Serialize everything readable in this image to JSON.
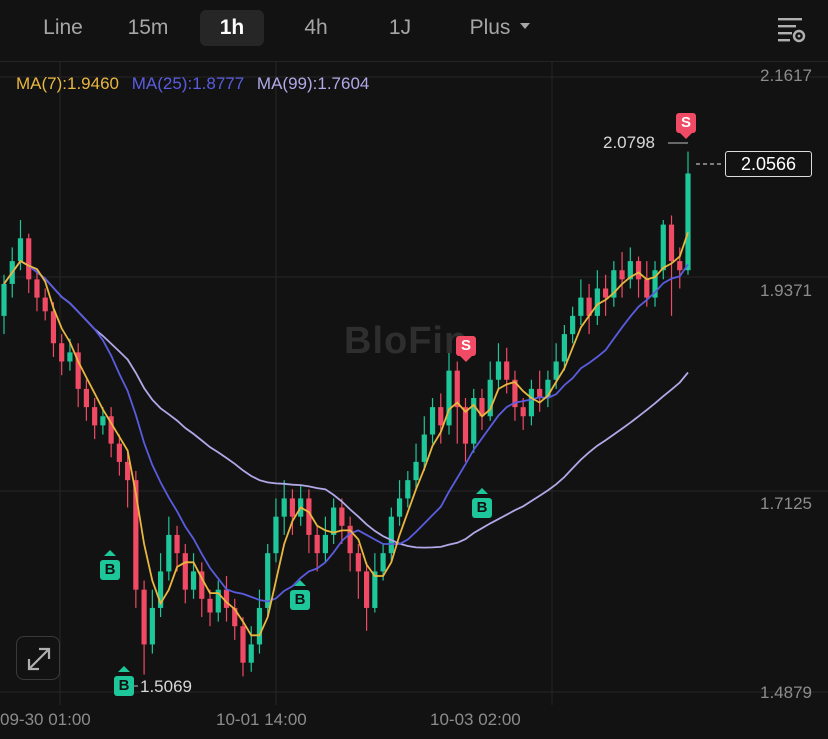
{
  "timeframes": [
    {
      "label": "Line",
      "active": false
    },
    {
      "label": "15m",
      "active": false
    },
    {
      "label": "1h",
      "active": true
    },
    {
      "label": "4h",
      "active": false
    },
    {
      "label": "1J",
      "active": false
    },
    {
      "label": "Plus",
      "active": false
    }
  ],
  "icons": {
    "settings": "chart-settings-icon",
    "expand": "expand-icon",
    "more": "caret-down-icon"
  },
  "ma_legend": [
    {
      "label": "MA(7):1.9460",
      "color": "#e9b73f"
    },
    {
      "label": "MA(25):1.8777",
      "color": "#5a5ce0"
    },
    {
      "label": "MA(99):1.7604",
      "color": "#b1a8e8"
    }
  ],
  "price_axis": {
    "ticks": [
      "2.1617",
      "1.9371",
      "1.7125",
      "1.4879"
    ]
  },
  "time_axis": {
    "ticks": [
      "09-30 01:00",
      "10-01 14:00",
      "10-03 02:00"
    ]
  },
  "last_price": "2.0566",
  "high_label": "2.0798",
  "low_label": "1.5069",
  "watermark": "BloFin",
  "markers": [
    {
      "type": "buy",
      "text": "B"
    },
    {
      "type": "buy",
      "text": "B"
    },
    {
      "type": "buy",
      "text": "B"
    },
    {
      "type": "buy",
      "text": "B"
    },
    {
      "type": "sell",
      "text": "S"
    },
    {
      "type": "sell",
      "text": "S"
    }
  ],
  "colors": {
    "up": "#1ec79a",
    "down": "#f04a64",
    "ma7": "#e9b73f",
    "ma25": "#5a5ce0",
    "ma99": "#b1a8e8",
    "grid": "#262626"
  },
  "chart_data": {
    "type": "candlestick",
    "ylim": [
      1.4879,
      2.1617
    ],
    "grid": true,
    "candles": [
      [
        1.9,
        1.935,
        1.88,
        1.945
      ],
      [
        1.935,
        1.96,
        1.92,
        1.975
      ],
      [
        1.96,
        1.985,
        1.95,
        2.005
      ],
      [
        1.985,
        1.94,
        1.925,
        1.99
      ],
      [
        1.94,
        1.92,
        1.905,
        1.95
      ],
      [
        1.92,
        1.905,
        1.895,
        1.93
      ],
      [
        1.905,
        1.87,
        1.855,
        1.915
      ],
      [
        1.87,
        1.85,
        1.835,
        1.88
      ],
      [
        1.85,
        1.86,
        1.84,
        1.875
      ],
      [
        1.86,
        1.82,
        1.8,
        1.87
      ],
      [
        1.82,
        1.8,
        1.785,
        1.83
      ],
      [
        1.8,
        1.78,
        1.765,
        1.81
      ],
      [
        1.78,
        1.79,
        1.77,
        1.8
      ],
      [
        1.79,
        1.76,
        1.745,
        1.8
      ],
      [
        1.76,
        1.74,
        1.725,
        1.77
      ],
      [
        1.74,
        1.72,
        1.69,
        1.75
      ],
      [
        1.72,
        1.6,
        1.58,
        1.73
      ],
      [
        1.6,
        1.54,
        1.507,
        1.61
      ],
      [
        1.54,
        1.58,
        1.53,
        1.6
      ],
      [
        1.58,
        1.62,
        1.57,
        1.64
      ],
      [
        1.62,
        1.66,
        1.61,
        1.68
      ],
      [
        1.66,
        1.64,
        1.62,
        1.67
      ],
      [
        1.64,
        1.6,
        1.585,
        1.65
      ],
      [
        1.6,
        1.62,
        1.59,
        1.64
      ],
      [
        1.62,
        1.59,
        1.57,
        1.63
      ],
      [
        1.59,
        1.575,
        1.56,
        1.6
      ],
      [
        1.575,
        1.6,
        1.565,
        1.61
      ],
      [
        1.6,
        1.58,
        1.565,
        1.615
      ],
      [
        1.58,
        1.56,
        1.545,
        1.59
      ],
      [
        1.56,
        1.52,
        1.505,
        1.57
      ],
      [
        1.52,
        1.54,
        1.51,
        1.56
      ],
      [
        1.54,
        1.58,
        1.53,
        1.6
      ],
      [
        1.58,
        1.64,
        1.57,
        1.65
      ],
      [
        1.64,
        1.68,
        1.63,
        1.7
      ],
      [
        1.68,
        1.7,
        1.66,
        1.72
      ],
      [
        1.7,
        1.68,
        1.66,
        1.71
      ],
      [
        1.68,
        1.7,
        1.67,
        1.715
      ],
      [
        1.7,
        1.66,
        1.64,
        1.71
      ],
      [
        1.66,
        1.64,
        1.62,
        1.67
      ],
      [
        1.64,
        1.66,
        1.63,
        1.68
      ],
      [
        1.66,
        1.69,
        1.65,
        1.7
      ],
      [
        1.69,
        1.67,
        1.65,
        1.7
      ],
      [
        1.67,
        1.64,
        1.62,
        1.68
      ],
      [
        1.64,
        1.62,
        1.59,
        1.65
      ],
      [
        1.62,
        1.58,
        1.555,
        1.63
      ],
      [
        1.58,
        1.62,
        1.575,
        1.64
      ],
      [
        1.62,
        1.64,
        1.61,
        1.65
      ],
      [
        1.64,
        1.68,
        1.63,
        1.69
      ],
      [
        1.68,
        1.7,
        1.67,
        1.72
      ],
      [
        1.7,
        1.72,
        1.69,
        1.73
      ],
      [
        1.72,
        1.74,
        1.71,
        1.76
      ],
      [
        1.74,
        1.77,
        1.73,
        1.79
      ],
      [
        1.77,
        1.8,
        1.76,
        1.81
      ],
      [
        1.8,
        1.78,
        1.76,
        1.815
      ],
      [
        1.78,
        1.84,
        1.77,
        1.88
      ],
      [
        1.84,
        1.8,
        1.76,
        1.85
      ],
      [
        1.8,
        1.76,
        1.74,
        1.81
      ],
      [
        1.76,
        1.81,
        1.75,
        1.82
      ],
      [
        1.81,
        1.79,
        1.775,
        1.82
      ],
      [
        1.79,
        1.83,
        1.785,
        1.85
      ],
      [
        1.83,
        1.85,
        1.82,
        1.87
      ],
      [
        1.85,
        1.83,
        1.815,
        1.865
      ],
      [
        1.83,
        1.8,
        1.785,
        1.84
      ],
      [
        1.8,
        1.79,
        1.775,
        1.81
      ],
      [
        1.79,
        1.82,
        1.78,
        1.83
      ],
      [
        1.82,
        1.81,
        1.795,
        1.84
      ],
      [
        1.81,
        1.83,
        1.8,
        1.84
      ],
      [
        1.83,
        1.85,
        1.82,
        1.87
      ],
      [
        1.85,
        1.88,
        1.84,
        1.89
      ],
      [
        1.88,
        1.9,
        1.87,
        1.91
      ],
      [
        1.9,
        1.92,
        1.89,
        1.94
      ],
      [
        1.92,
        1.9,
        1.88,
        1.935
      ],
      [
        1.9,
        1.93,
        1.89,
        1.95
      ],
      [
        1.93,
        1.92,
        1.9,
        1.945
      ],
      [
        1.92,
        1.95,
        1.91,
        1.96
      ],
      [
        1.95,
        1.94,
        1.92,
        1.97
      ],
      [
        1.94,
        1.96,
        1.93,
        1.975
      ],
      [
        1.96,
        1.94,
        1.92,
        1.965
      ],
      [
        1.94,
        1.92,
        1.91,
        1.96
      ],
      [
        1.92,
        1.95,
        1.91,
        1.96
      ],
      [
        1.95,
        2.0,
        1.94,
        2.005
      ],
      [
        2.0,
        1.96,
        1.9,
        2.01
      ],
      [
        1.96,
        1.95,
        1.93,
        1.975
      ],
      [
        1.95,
        2.056,
        1.945,
        2.08
      ]
    ]
  }
}
